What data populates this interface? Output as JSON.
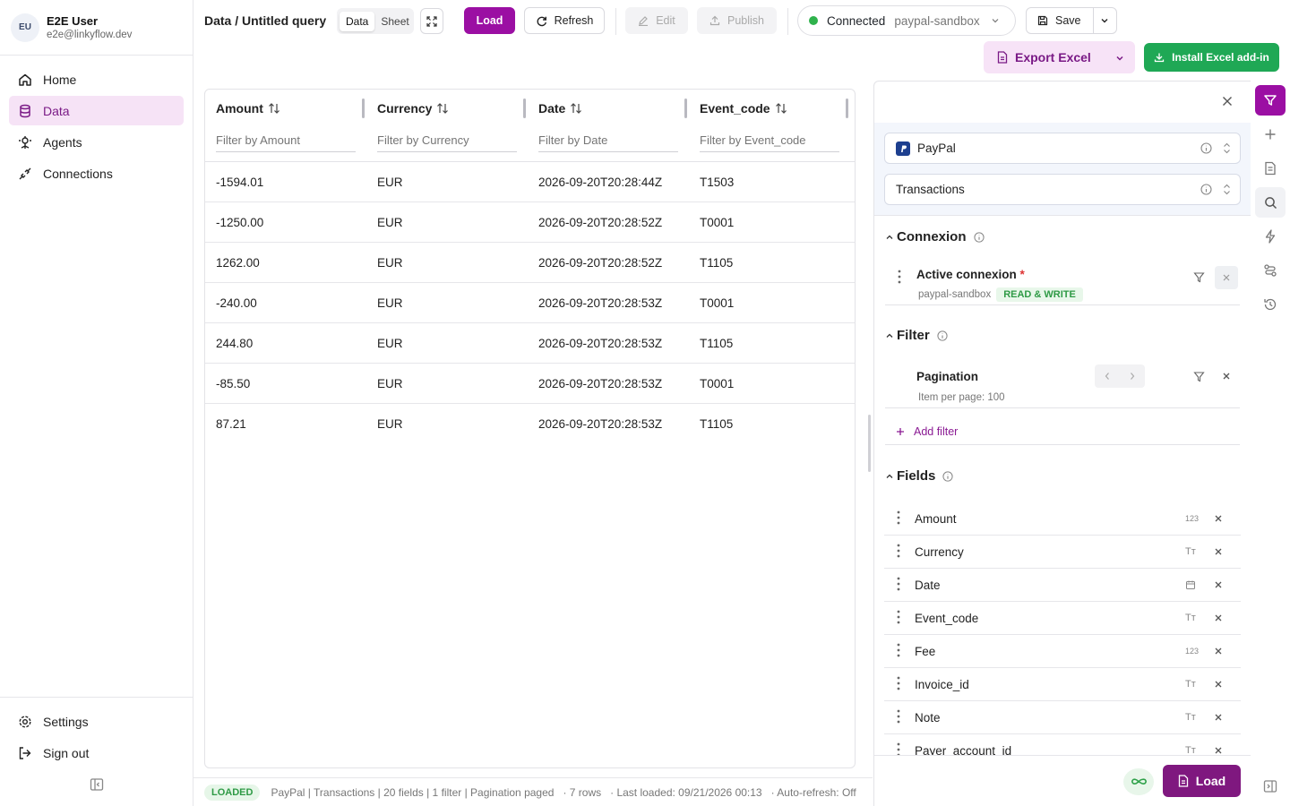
{
  "user": {
    "initials": "EU",
    "name": "E2E User",
    "email": "e2e@linkyflow.dev"
  },
  "nav": {
    "items": [
      {
        "label": "Home",
        "icon": "home-icon",
        "active": false
      },
      {
        "label": "Data",
        "icon": "database-icon",
        "active": true
      },
      {
        "label": "Agents",
        "icon": "agent-icon",
        "active": false
      },
      {
        "label": "Connections",
        "icon": "plug-icon",
        "active": false
      }
    ],
    "settings": "Settings",
    "signout": "Sign out"
  },
  "toolbar": {
    "breadcrumb": "Data / Untitled query",
    "view_data": "Data",
    "view_sheet": "Sheet",
    "load": "Load",
    "refresh": "Refresh",
    "edit": "Edit",
    "publish": "Publish",
    "connected": "Connected",
    "connection_name": "paypal-sandbox",
    "save": "Save",
    "export_excel": "Export Excel",
    "install_addin": "Install Excel add-in"
  },
  "table": {
    "columns": [
      {
        "label": "Amount",
        "filter": "Filter by Amount"
      },
      {
        "label": "Currency",
        "filter": "Filter by Currency"
      },
      {
        "label": "Date",
        "filter": "Filter by Date"
      },
      {
        "label": "Event_code",
        "filter": "Filter by Event_code"
      }
    ],
    "rows": [
      [
        "-1594.01",
        "EUR",
        "2026-09-20T20:28:44Z",
        "T1503"
      ],
      [
        "-1250.00",
        "EUR",
        "2026-09-20T20:28:52Z",
        "T0001"
      ],
      [
        "1262.00",
        "EUR",
        "2026-09-20T20:28:52Z",
        "T1105"
      ],
      [
        "-240.00",
        "EUR",
        "2026-09-20T20:28:53Z",
        "T0001"
      ],
      [
        "244.80",
        "EUR",
        "2026-09-20T20:28:53Z",
        "T1105"
      ],
      [
        "-85.50",
        "EUR",
        "2026-09-20T20:28:53Z",
        "T0001"
      ],
      [
        "87.21",
        "EUR",
        "2026-09-20T20:28:53Z",
        "T1105"
      ]
    ]
  },
  "status": {
    "badge": "LOADED",
    "summary": "PayPal | Transactions | 20 fields | 1 filter | Pagination paged",
    "rows": "· 7 rows",
    "last_loaded": "· Last loaded: 09/21/2026 00:13",
    "auto_refresh": "· Auto-refresh: Off"
  },
  "panel": {
    "source": "PayPal",
    "object": "Transactions",
    "connexion_title": "Connexion",
    "active_connexion": "Active connexion",
    "required_mark": "*",
    "connexion_sub": "paypal-sandbox",
    "access": "READ & WRITE",
    "filter_title": "Filter",
    "pagination": "Pagination",
    "pagination_sub": "Item per page: 100",
    "add_filter": "Add filter",
    "fields_title": "Fields",
    "fields": [
      {
        "name": "Amount",
        "type": "123"
      },
      {
        "name": "Currency",
        "type": "Tт"
      },
      {
        "name": "Date",
        "type": "calendar"
      },
      {
        "name": "Event_code",
        "type": "Tт"
      },
      {
        "name": "Fee",
        "type": "123"
      },
      {
        "name": "Invoice_id",
        "type": "Tт"
      },
      {
        "name": "Note",
        "type": "Tт"
      },
      {
        "name": "Payer_account_id",
        "type": "Tт"
      }
    ],
    "load": "Load"
  },
  "colors": {
    "accent": "#9b0fa3",
    "accent_dark": "#7f187f",
    "success": "#2fb24c",
    "excel_green": "#1fa855"
  }
}
